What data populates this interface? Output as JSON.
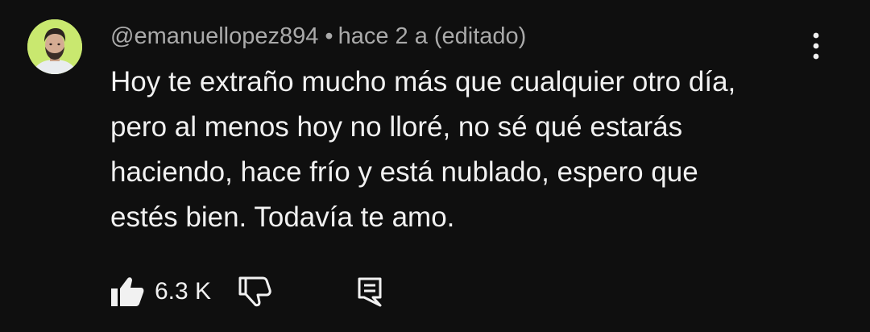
{
  "comment": {
    "author_handle": "@emanuellopez894",
    "separator": "•",
    "timestamp": "hace 2 a (editado)",
    "text": "Hoy te extraño mucho más que cualquier otro día,\npero al menos hoy no lloré, no sé qué estarás\nhaciendo, hace frío y está nublado, espero que\nestés bien. Todavía te amo.",
    "like_count": "6.3 K"
  },
  "icons": {
    "avatar": "avatar-photo",
    "menu": "more-vertical-icon",
    "like": "thumbs-up-filled-icon",
    "dislike": "thumbs-down-outline-icon",
    "reply": "comment-reply-icon"
  },
  "colors": {
    "background": "#0f0f0f",
    "text_primary": "#f1f1f1",
    "text_secondary": "#aaaaaa",
    "avatar_bg": "#c9e86f"
  }
}
